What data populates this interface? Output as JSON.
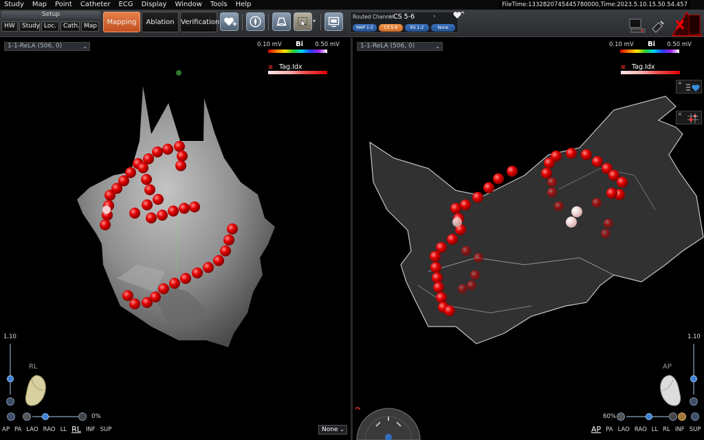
{
  "menu": [
    "Study",
    "Map",
    "Point",
    "Catheter",
    "ECG",
    "Display",
    "Window",
    "Tools",
    "Help"
  ],
  "file_time": "FileTime:1332820745445780000,Time:2023.5.10.15.50.54.457",
  "setup": {
    "label": "Setup",
    "buttons": [
      "HW",
      "Study",
      "Loc.",
      "Cath.",
      "Map"
    ]
  },
  "modes": {
    "mapping": "Mapping",
    "ablation": "Ablation",
    "verification": "Verification",
    "active": "Mapping"
  },
  "routed_channel": {
    "label": "Routed Channel",
    "value": "CS 5-6",
    "channels": [
      "MAP 1-2",
      "CS 5-6",
      "RS 1-2",
      "None"
    ],
    "selected": "CS 5-6"
  },
  "left_view": {
    "map_selector": "1-1-ReLA (506, 0)",
    "scale_min": "0.10 mV",
    "scale_mode": "Bi",
    "scale_max": "0.50 mV",
    "tag_label": "Tag.Idx",
    "zoom": "1.10",
    "view_label": "RL",
    "opacity": "0%",
    "orientations": [
      "AP",
      "PA",
      "LAO",
      "RAO",
      "LL",
      "RL",
      "INF",
      "SUP"
    ],
    "selected_orientation": "RL",
    "display_select": "None"
  },
  "right_view": {
    "map_selector": "1-1-ReLA (506, 0)",
    "scale_min": "0.10 mV",
    "scale_mode": "Bi",
    "scale_max": "0.50 mV",
    "tag_label": "Tag.Idx",
    "zoom": "1.10",
    "view_label": "AP",
    "opacity": "60%",
    "orientations": [
      "AP",
      "PA",
      "LAO",
      "RAO",
      "LL",
      "RL",
      "INF",
      "SUP"
    ],
    "selected_orientation": "AP"
  },
  "colors": {
    "mapping_active": "#e07035",
    "ablation_tag": "#e00000",
    "anatomy_gray": "#8c8c8c",
    "toolbar_bg": "#2f3236"
  }
}
